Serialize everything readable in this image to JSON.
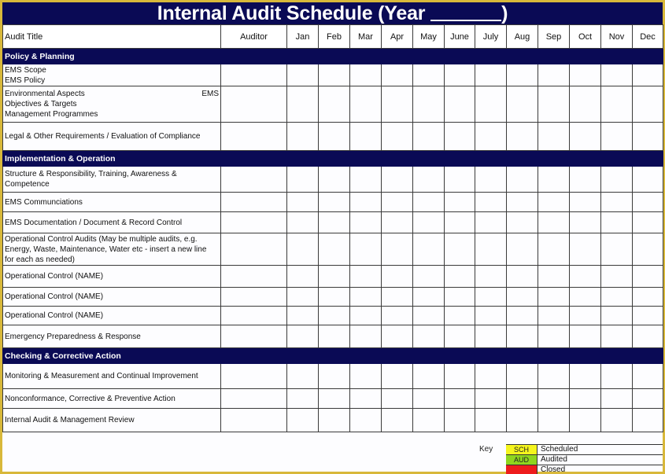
{
  "title": {
    "prefix": "Internal Audit Schedule (Year ",
    "suffix": ")"
  },
  "columns": {
    "audit_title": "Audit Title",
    "auditor": "Auditor",
    "months": [
      "Jan",
      "Feb",
      "Mar",
      "Apr",
      "May",
      "June",
      "July",
      "Aug",
      "Sep",
      "Oct",
      "Nov",
      "Dec"
    ]
  },
  "sections": [
    {
      "name": "Policy & Planning",
      "rows": [
        {
          "lines": [
            "EMS Scope",
            "EMS Policy"
          ],
          "right": ""
        },
        {
          "lines": [
            "Environmental Aspects",
            "Objectives & Targets",
            "Management Programmes"
          ],
          "right": "EMS"
        },
        {
          "lines": [
            "Legal & Other Requirements / Evaluation of Compliance"
          ],
          "right": ""
        }
      ]
    },
    {
      "name": "Implementation & Operation",
      "rows": [
        {
          "lines": [
            "Structure & Responsibility, Training, Awareness &",
            "Competence"
          ],
          "right": ""
        },
        {
          "lines": [
            "EMS Communciations"
          ],
          "right": ""
        },
        {
          "lines": [
            "EMS Documentation / Document & Record Control"
          ],
          "right": ""
        },
        {
          "lines": [
            "Operational Control Audits (May be multiple audits, e.g.",
            "Energy, Waste, Maintenance, Water etc - insert a new line",
            "for each as needed)"
          ],
          "right": ""
        },
        {
          "lines": [
            "Operational Control (NAME)"
          ],
          "right": ""
        },
        {
          "lines": [
            "Operational Control (NAME)"
          ],
          "right": ""
        },
        {
          "lines": [
            "Operational Control (NAME)"
          ],
          "right": ""
        },
        {
          "lines": [
            "Emergency Preparedness & Response"
          ],
          "right": ""
        }
      ]
    },
    {
      "name": "Checking & Corrective Action",
      "rows": [
        {
          "lines": [
            "Monitoring & Measurement and Continual Improvement"
          ],
          "right": ""
        },
        {
          "lines": [
            "Nonconformance, Corrective & Preventive Action"
          ],
          "right": ""
        },
        {
          "lines": [
            "Internal Audit & Management Review"
          ],
          "right": ""
        }
      ]
    }
  ],
  "key": {
    "label": "Key",
    "items": [
      {
        "code": "SCH",
        "text": "Scheduled",
        "color": "#f5f51e"
      },
      {
        "code": "AUD",
        "text": "Audited",
        "color": "#8fd61e"
      },
      {
        "code": "",
        "text": "Closed",
        "color": "#ee1c1c"
      }
    ]
  },
  "colors": {
    "header_bg": "#0a0a55",
    "frame": "#d8b83a"
  }
}
